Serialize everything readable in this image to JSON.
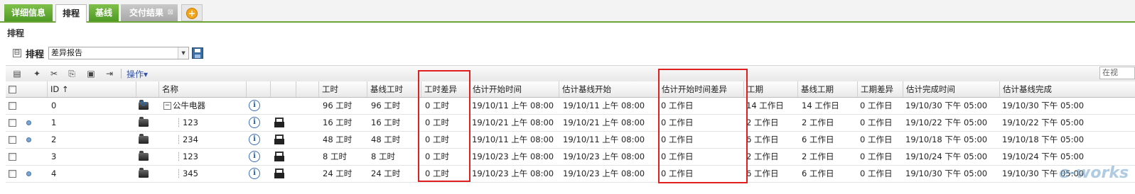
{
  "tabs": [
    {
      "label": "详细信息"
    },
    {
      "label": "排程"
    },
    {
      "label": "基线"
    },
    {
      "label": "交付结果",
      "close": "⊠"
    },
    {
      "add": "+"
    }
  ],
  "section_title": "排程",
  "schedule": {
    "collapse": "⊟",
    "label": "排程",
    "report_select": "差异报告"
  },
  "toolbar": {
    "ops_label": "操作▾",
    "search_placeholder": "在视"
  },
  "columns": {
    "id": "ID ↑",
    "name": "名称",
    "work": "工时",
    "baseline_work": "基线工时",
    "work_variance": "工时差异",
    "est_start": "估计开始时间",
    "est_baseline_start": "估计基线开始",
    "est_start_variance": "估计开始时间差异",
    "duration": "工期",
    "baseline_duration": "基线工期",
    "duration_variance": "工期差异",
    "est_finish": "估计完成时间",
    "est_baseline_finish": "估计基线完成"
  },
  "rows": [
    {
      "id": "0",
      "name": "公牛电器",
      "work": "96 工时",
      "baseline_work": "96 工时",
      "work_variance": "0 工时",
      "est_start": "19/10/11 上午 08:00",
      "est_baseline_start": "19/10/11 上午 08:00",
      "est_start_variance": "0 工作日",
      "duration": "14 工作日",
      "baseline_duration": "14 工作日",
      "duration_variance": "0 工作日",
      "est_finish": "19/10/30 下午 05:00",
      "est_baseline_finish": "19/10/30 下午 05:00"
    },
    {
      "id": "1",
      "name": "123",
      "work": "16 工时",
      "baseline_work": "16 工时",
      "work_variance": "0 工时",
      "est_start": "19/10/21 上午 08:00",
      "est_baseline_start": "19/10/21 上午 08:00",
      "est_start_variance": "0 工作日",
      "duration": "2 工作日",
      "baseline_duration": "2 工作日",
      "duration_variance": "0 工作日",
      "est_finish": "19/10/22 下午 05:00",
      "est_baseline_finish": "19/10/22 下午 05:00"
    },
    {
      "id": "2",
      "name": "234",
      "work": "48 工时",
      "baseline_work": "48 工时",
      "work_variance": "0 工时",
      "est_start": "19/10/11 上午 08:00",
      "est_baseline_start": "19/10/11 上午 08:00",
      "est_start_variance": "0 工作日",
      "duration": "6 工作日",
      "baseline_duration": "6 工作日",
      "duration_variance": "0 工作日",
      "est_finish": "19/10/18 下午 05:00",
      "est_baseline_finish": "19/10/18 下午 05:00"
    },
    {
      "id": "3",
      "name": "123",
      "work": "8 工时",
      "baseline_work": "8 工时",
      "work_variance": "0 工时",
      "est_start": "19/10/23 上午 08:00",
      "est_baseline_start": "19/10/23 上午 08:00",
      "est_start_variance": "0 工作日",
      "duration": "2 工作日",
      "baseline_duration": "2 工作日",
      "duration_variance": "0 工作日",
      "est_finish": "19/10/24 下午 05:00",
      "est_baseline_finish": "19/10/24 下午 05:00"
    },
    {
      "id": "4",
      "name": "345",
      "work": "24 工时",
      "baseline_work": "24 工时",
      "work_variance": "0 工时",
      "est_start": "19/10/23 上午 08:00",
      "est_baseline_start": "19/10/23 上午 08:00",
      "est_start_variance": "0 工作日",
      "duration": "6 工作日",
      "baseline_duration": "6 工作日",
      "duration_variance": "0 工作日",
      "est_finish": "19/10/30 下午 05:00",
      "est_baseline_finish": "19/10/30 下午 05:00"
    }
  ],
  "watermark": "e-works"
}
